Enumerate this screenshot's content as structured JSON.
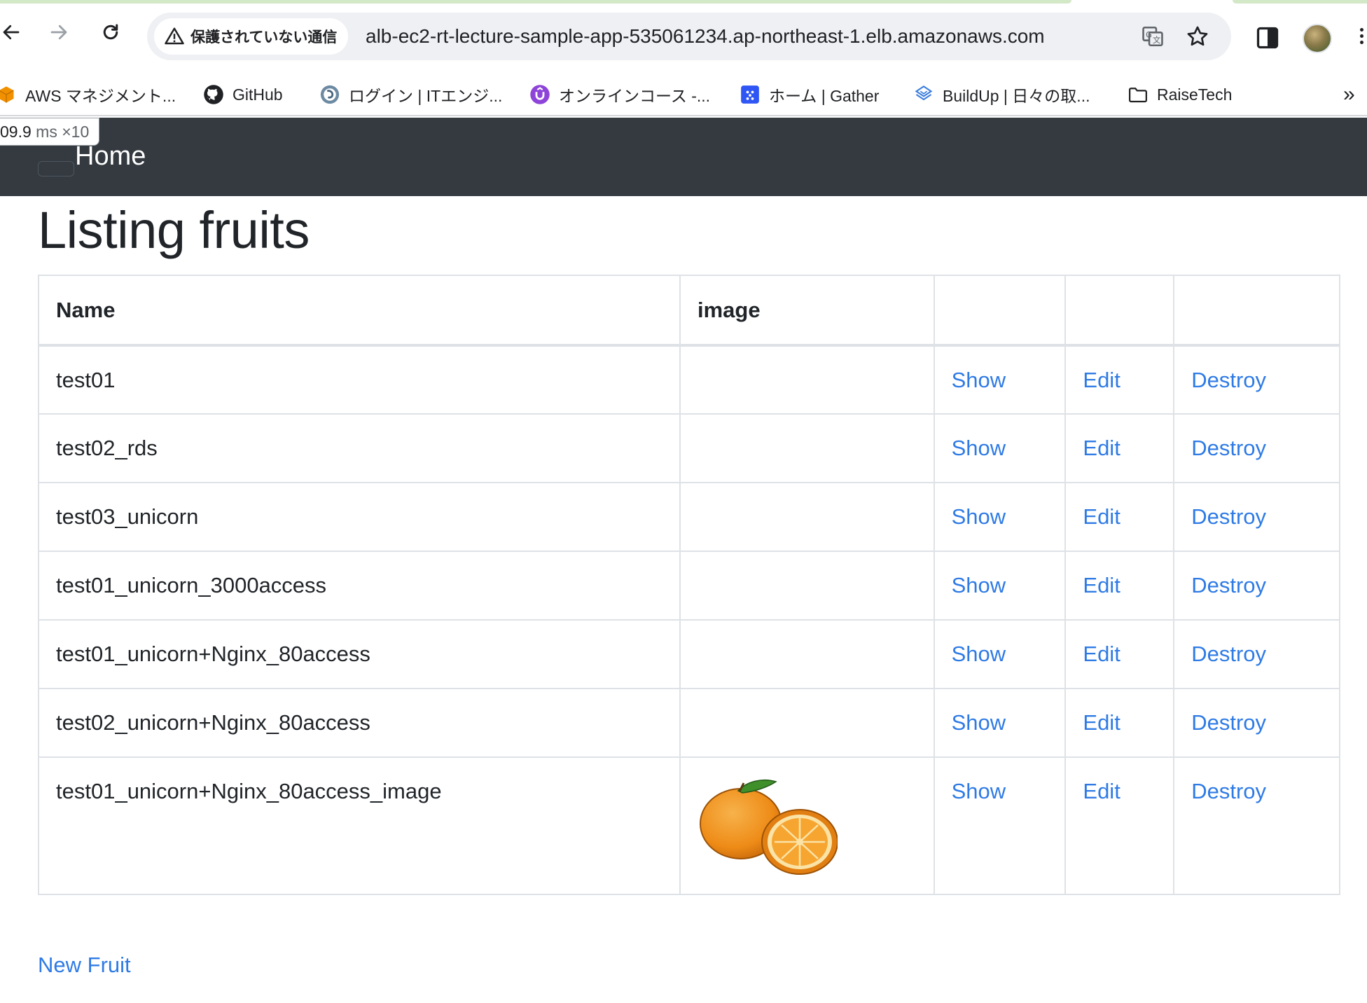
{
  "browser": {
    "security_label": "保護されていない通信",
    "url": "alb-ec2-rt-lecture-sample-app-535061234.ap-northeast-1.elb.amazonaws.com",
    "bookmarks": [
      {
        "label": "AWS マネジメント...",
        "icon": "aws-cube-icon"
      },
      {
        "label": "GitHub",
        "icon": "github-icon"
      },
      {
        "label": "ログイン | ITエンジ...",
        "icon": "globe-icon"
      },
      {
        "label": "オンラインコース -...",
        "icon": "udemy-icon"
      },
      {
        "label": "ホーム | Gather",
        "icon": "gather-icon"
      },
      {
        "label": "BuildUp | 日々の取...",
        "icon": "buildup-icon"
      },
      {
        "label": "RaiseTech",
        "icon": "folder-icon"
      }
    ],
    "bookmarks_more": "»"
  },
  "perf_badge": {
    "value": "09.9",
    "unit": "ms",
    "multiplier": "×10"
  },
  "navbar": {
    "brand": "Home"
  },
  "page": {
    "title": "Listing fruits",
    "new_link": "New Fruit"
  },
  "table": {
    "headers": [
      "Name",
      "image",
      "",
      "",
      ""
    ],
    "action_labels": {
      "show": "Show",
      "edit": "Edit",
      "destroy": "Destroy"
    },
    "rows": [
      {
        "name": "test01",
        "has_image": false
      },
      {
        "name": "test02_rds",
        "has_image": false
      },
      {
        "name": "test03_unicorn",
        "has_image": false
      },
      {
        "name": "test01_unicorn_3000access",
        "has_image": false
      },
      {
        "name": "test01_unicorn+Nginx_80access",
        "has_image": false
      },
      {
        "name": "test02_unicorn+Nginx_80access",
        "has_image": false
      },
      {
        "name": "test01_unicorn+Nginx_80access_image",
        "has_image": true,
        "image_icon": "orange-image"
      }
    ]
  },
  "colors": {
    "navbar_bg": "#343a40",
    "link": "#2f7be5",
    "table_border": "#dee2e6",
    "text": "#212529"
  }
}
